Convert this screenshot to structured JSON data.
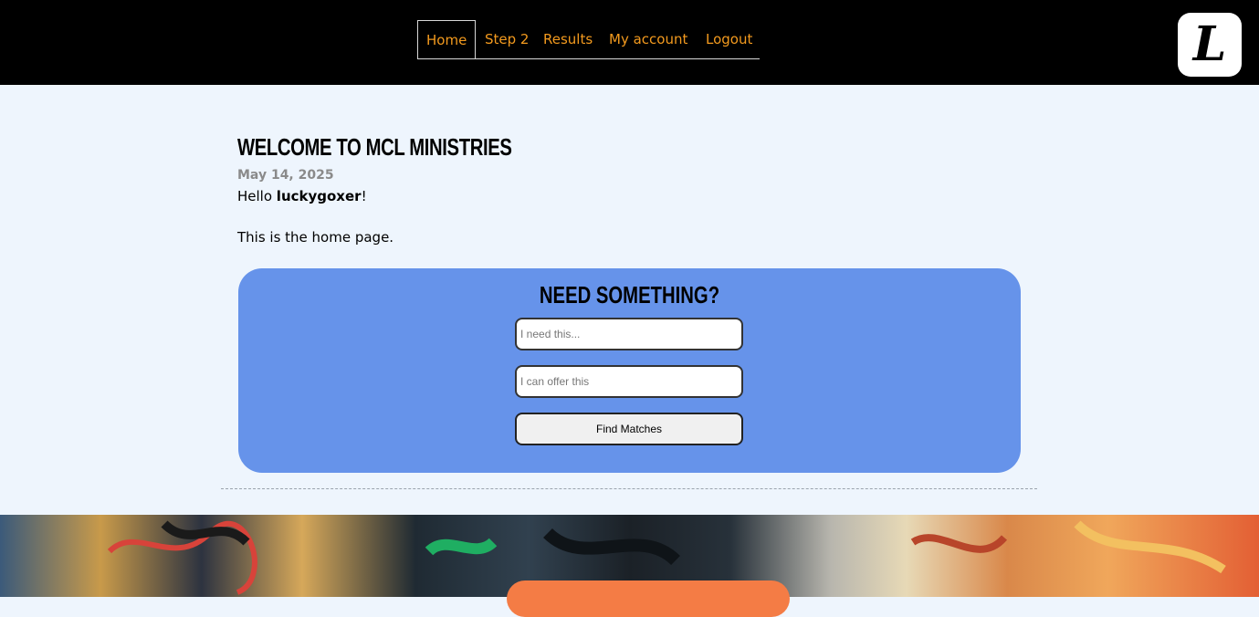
{
  "nav": {
    "items": [
      {
        "label": "Home",
        "active": true
      },
      {
        "label": "Step 2",
        "active": false
      },
      {
        "label": "Results",
        "active": false
      },
      {
        "label": "My account",
        "active": false
      },
      {
        "label": "Logout",
        "active": false
      }
    ],
    "accent_color": "#f39a1e"
  },
  "logo": {
    "glyph": "L"
  },
  "page": {
    "title": "WELCOME TO MCL MINISTRIES",
    "date": "May 14, 2025",
    "greeting_prefix": "Hello ",
    "username": "luckygoxer",
    "greeting_suffix": "!",
    "intro": "This is the home page."
  },
  "match_form": {
    "title": "NEED SOMETHING?",
    "need_placeholder": "I need this...",
    "offer_placeholder": "I can offer this",
    "submit_label": "Find Matches",
    "card_color": "#6693ea"
  },
  "footer": {
    "button_color": "#f47c45"
  }
}
